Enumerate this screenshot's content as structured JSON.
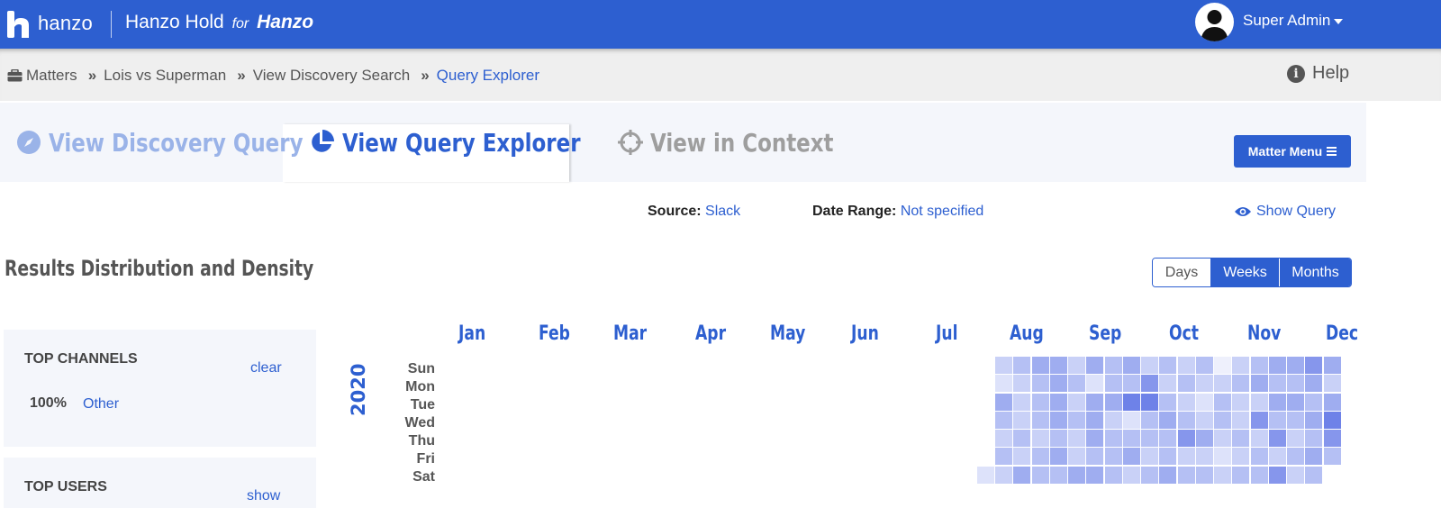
{
  "header": {
    "logo_text": "hanzo",
    "app_name": "Hanzo Hold",
    "for_text": "for",
    "org_name": "Hanzo",
    "user_name": "Super Admin"
  },
  "breadcrumb": {
    "items": [
      "Matters",
      "Lois vs Superman",
      "View Discovery Search",
      "Query Explorer"
    ],
    "help_label": "Help"
  },
  "tabs": [
    {
      "label": "View Discovery Query",
      "active": false,
      "icon": "compass-icon"
    },
    {
      "label": "View Query Explorer",
      "active": true,
      "icon": "pie-chart-icon"
    },
    {
      "label": "View in Context",
      "active": false,
      "icon": "crosshairs-icon"
    }
  ],
  "matter_menu_label": "Matter Menu",
  "filters": {
    "source_label": "Source:",
    "source_value": "Slack",
    "date_range_label": "Date Range:",
    "date_range_value": "Not specified",
    "show_query_label": "Show Query"
  },
  "section_title": "Results Distribution and Density",
  "granularity": {
    "options": [
      "Days",
      "Weeks",
      "Months"
    ],
    "active": [
      "Weeks",
      "Months"
    ]
  },
  "top_channels": {
    "title": "TOP CHANNELS",
    "action": "clear",
    "items": [
      {
        "percent": "100%",
        "label": "Other"
      }
    ]
  },
  "top_users": {
    "title": "TOP USERS",
    "action": "show"
  },
  "heatmap": {
    "year": "2020",
    "months": [
      "Jan",
      "Feb",
      "Mar",
      "Apr",
      "May",
      "Jun",
      "Jul",
      "Aug",
      "Sep",
      "Oct",
      "Nov",
      "Dec"
    ],
    "days": [
      "Sun",
      "Mon",
      "Tue",
      "Wed",
      "Thu",
      "Fri",
      "Sat"
    ],
    "first_data_week": 30,
    "first_data_day": 6,
    "colors": [
      "#eef0fc",
      "#dde2fa",
      "#c9d1f7",
      "#b5c0f4",
      "#9fadf0",
      "#8696ec",
      "#6e82e8"
    ],
    "weeks": [
      [
        null,
        null,
        null,
        null,
        null,
        null,
        1
      ],
      [
        2,
        1,
        4,
        3,
        2,
        3,
        2
      ],
      [
        3,
        2,
        2,
        2,
        3,
        2,
        4
      ],
      [
        4,
        3,
        3,
        3,
        2,
        3,
        3
      ],
      [
        4,
        4,
        4,
        4,
        3,
        4,
        3
      ],
      [
        2,
        3,
        2,
        3,
        2,
        2,
        4
      ],
      [
        4,
        1,
        4,
        4,
        4,
        3,
        4
      ],
      [
        3,
        3,
        4,
        2,
        3,
        3,
        3
      ],
      [
        4,
        3,
        6,
        1,
        3,
        4,
        2
      ],
      [
        2,
        5,
        6,
        3,
        3,
        2,
        3
      ],
      [
        3,
        2,
        3,
        4,
        3,
        3,
        4
      ],
      [
        2,
        3,
        2,
        3,
        5,
        2,
        3
      ],
      [
        3,
        2,
        1,
        2,
        4,
        2,
        3
      ],
      [
        0,
        2,
        3,
        3,
        2,
        1,
        2
      ],
      [
        2,
        3,
        2,
        2,
        3,
        2,
        3
      ],
      [
        3,
        4,
        2,
        5,
        2,
        3,
        3
      ],
      [
        4,
        3,
        4,
        3,
        5,
        2,
        5
      ],
      [
        4,
        3,
        4,
        3,
        2,
        3,
        2
      ],
      [
        5,
        4,
        3,
        4,
        3,
        4,
        3
      ],
      [
        4,
        2,
        4,
        6,
        5,
        3,
        null
      ]
    ]
  }
}
